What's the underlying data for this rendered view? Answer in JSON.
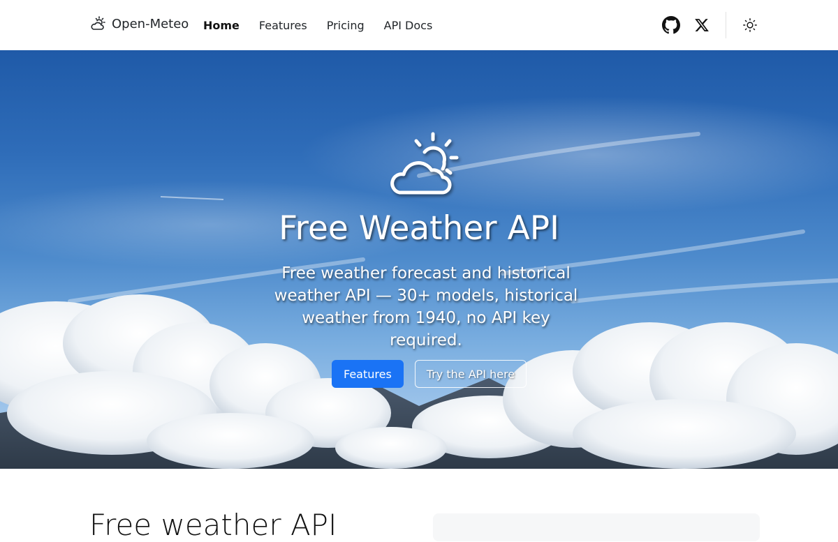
{
  "nav": {
    "brand": "Open-Meteo",
    "links": [
      {
        "label": "Home",
        "active": true
      },
      {
        "label": "Features",
        "active": false
      },
      {
        "label": "Pricing",
        "active": false
      },
      {
        "label": "API Docs",
        "active": false
      }
    ],
    "icons": [
      "github-icon",
      "x-icon",
      "sun-theme-icon"
    ]
  },
  "hero": {
    "icon": "cloud-sun-icon",
    "title": "Free Weather API",
    "subtitle": "Free weather forecast and historical weather API — 30+ models, historical weather from 1940, no API key required.",
    "primary_button": "Features",
    "secondary_button": "Try the API here"
  },
  "section": {
    "title": "Free weather API"
  },
  "colors": {
    "accent": "#1a73f5",
    "sky": "#2f6db9"
  }
}
